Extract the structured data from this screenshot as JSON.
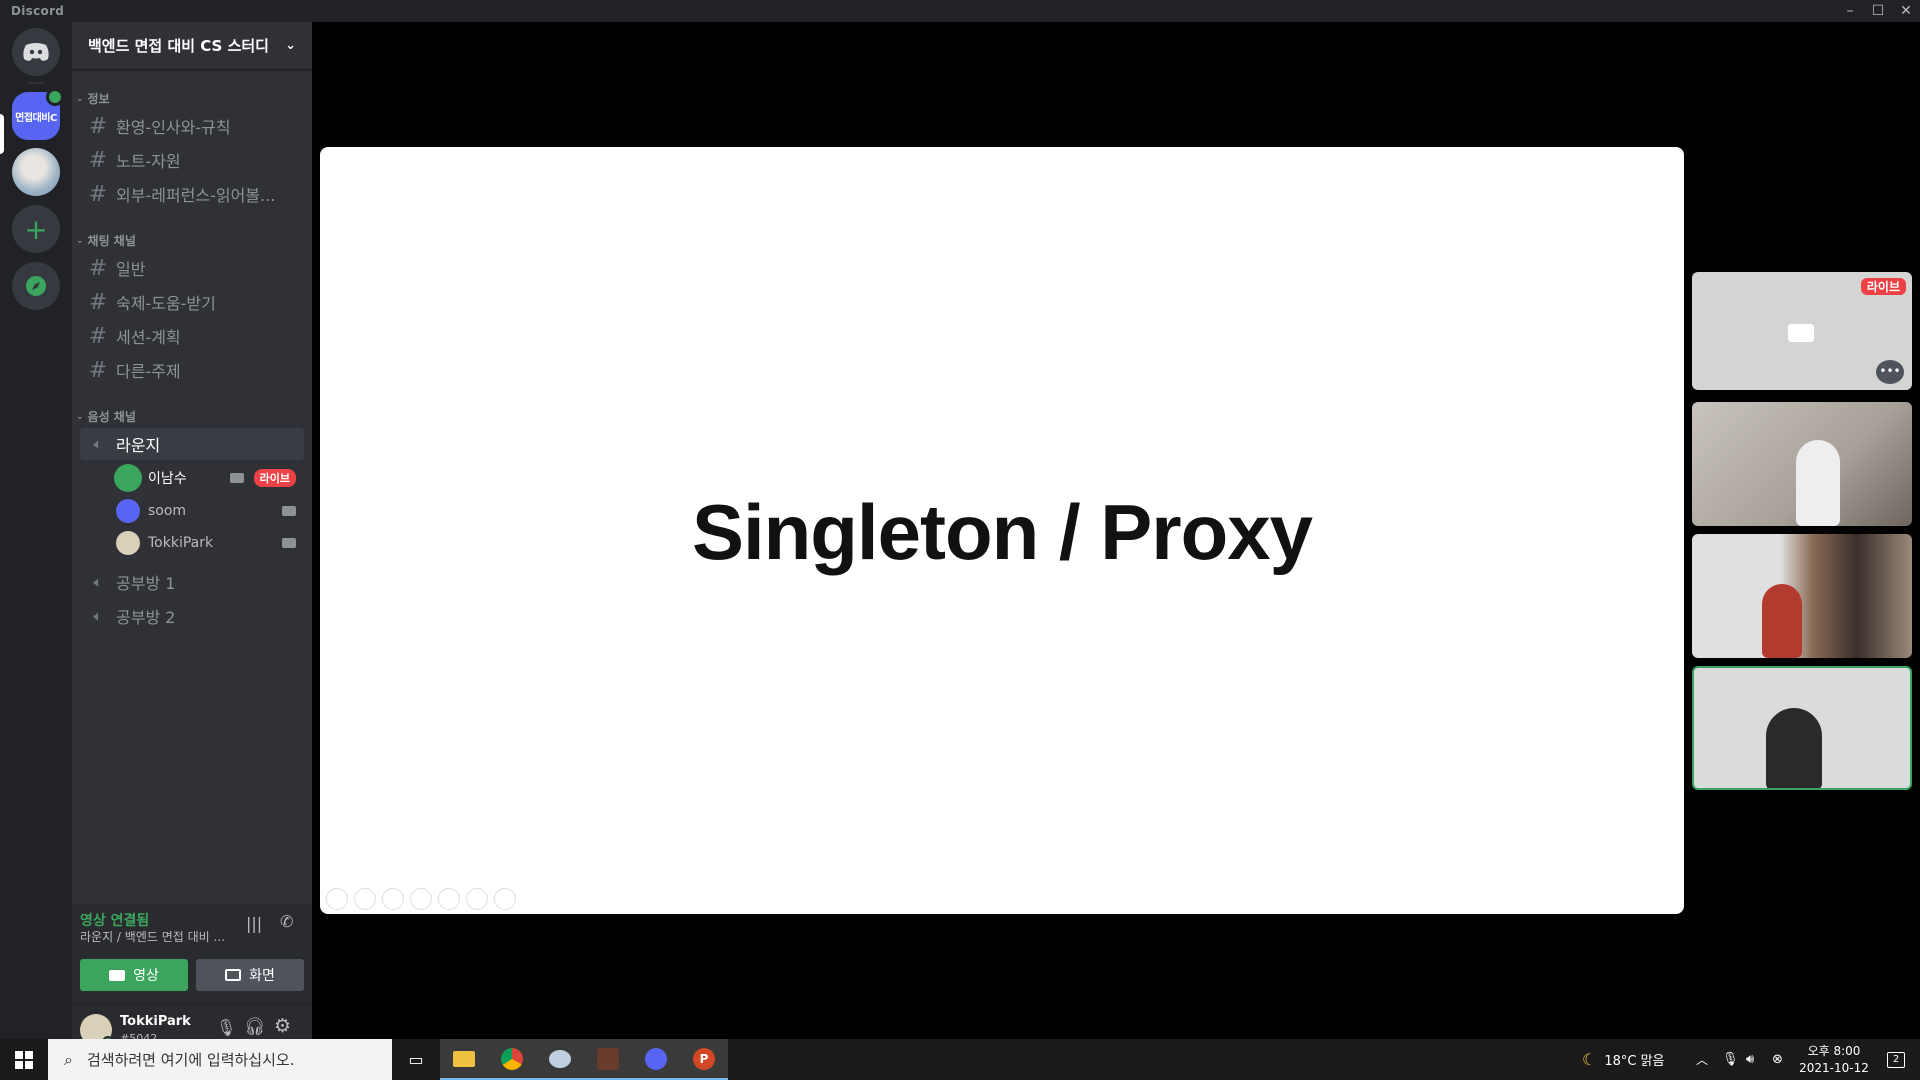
{
  "window": {
    "title": "Discord"
  },
  "guilds": {
    "selected_label": "면접대비C"
  },
  "server": {
    "name": "백엔드 면접 대비 CS 스터디"
  },
  "categories": [
    {
      "label": "정보",
      "channels": [
        "환영-인사와-규칙",
        "노트-자원",
        "외부-레퍼런스-읽어볼..."
      ]
    },
    {
      "label": "채팅 채널",
      "channels": [
        "일반",
        "숙제-도움-받기",
        "세션-계획",
        "다른-주제"
      ]
    },
    {
      "label": "음성 채널"
    }
  ],
  "voice": {
    "active_channel": "라운지",
    "members": [
      {
        "name": "이남수",
        "live": "라이브"
      },
      {
        "name": "soom"
      },
      {
        "name": "TokkiPark"
      }
    ],
    "other_channels": [
      "공부방 1",
      "공부방 2"
    ]
  },
  "voice_panel": {
    "status": "영상 연결됨",
    "subtitle": "라운지 / 백엔드 면접 대비 ...",
    "video_label": "영상",
    "screen_label": "화면"
  },
  "user": {
    "name": "TokkiPark",
    "tag": "#5042"
  },
  "stage": {
    "slide_title": "Singleton / Proxy",
    "tile_live_badge": "라이브"
  },
  "taskbar": {
    "search_placeholder": "검색하려면 여기에 입력하십시오.",
    "weather": "18°C 맑음",
    "time": "오후 8:00",
    "date": "2021-10-12",
    "notifications": "2"
  },
  "colors": {
    "accent": "#5865f2",
    "green": "#3ba55d",
    "live_red": "#ed4245"
  }
}
